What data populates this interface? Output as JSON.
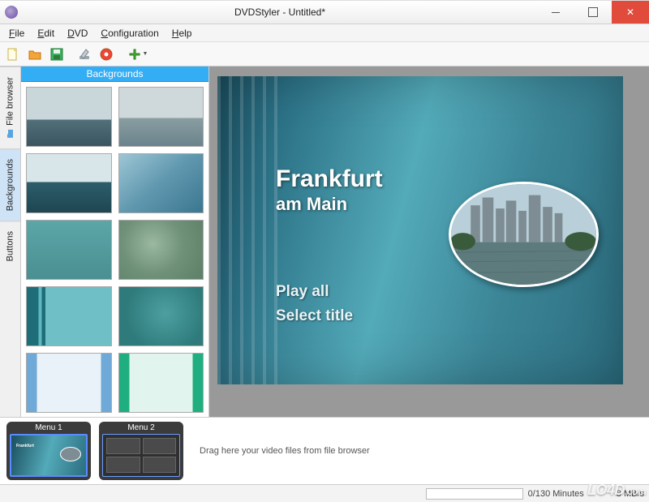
{
  "window": {
    "title": "DVDStyler - Untitled*"
  },
  "menus": {
    "file": "File",
    "edit": "Edit",
    "dvd": "DVD",
    "configuration": "Configuration",
    "help": "Help"
  },
  "toolbar": {
    "new": "new-project",
    "open": "open-project",
    "save": "save-project",
    "settings": "settings",
    "burn": "burn-dvd",
    "add": "add"
  },
  "sidetabs": {
    "file_browser": "File browser",
    "backgrounds": "Backgrounds",
    "buttons": "Buttons",
    "active": "backgrounds"
  },
  "panel": {
    "header": "Backgrounds",
    "thumbs": [
      {
        "id": "bg-ocean-island",
        "css": "linear-gradient(#c9d6da 55%,#52707a 55%,#3a5560)"
      },
      {
        "id": "bg-coast-boat",
        "css": "linear-gradient(#cfd8da 52%,#8a9ea2 52%,#6a838c)"
      },
      {
        "id": "bg-bay-point",
        "css": "linear-gradient(#d8e6ea 48%,#2d5d6b 48%,#1e4652)"
      },
      {
        "id": "bg-blue-haze",
        "css": "linear-gradient(140deg,#9dc6d6,#5f97ae,#3b7790)"
      },
      {
        "id": "bg-teal-flat",
        "css": "linear-gradient(#5ca6a8,#4a8f92)"
      },
      {
        "id": "bg-green-cloud",
        "css": "radial-gradient(circle at 40% 40%,#9bb8a1,#6f9178,#5c7f66)"
      },
      {
        "id": "bg-teal-stripes",
        "css": "linear-gradient(90deg,#1e6d78 0 14%,#5fb7bf 14% 18%,#1e6d78 18% 22%,#6fbfc6 22% 100%)"
      },
      {
        "id": "bg-teal-noise",
        "css": "radial-gradient(circle at 55% 45%,#4da0a0,#2f7b7c 70%)"
      },
      {
        "id": "bg-blue-bars",
        "css": "linear-gradient(90deg,#6fa9d8 0 12%,#e9f2f8 12% 88%,#6fa9d8 88% 100%)"
      },
      {
        "id": "bg-green-bars",
        "css": "linear-gradient(90deg,#1fae80 0 12%,#e1f5ee 12% 88%,#1fae80 88% 100%)"
      }
    ]
  },
  "preview": {
    "title_main": "Frankfurt",
    "title_sub": "am Main",
    "option1": "Play all",
    "option2": "Select title"
  },
  "timeline": {
    "items": [
      {
        "label": "Menu 1",
        "type": "preview",
        "selected": true
      },
      {
        "label": "Menu 2",
        "type": "grid4",
        "selected": false
      }
    ],
    "hint": "Drag here your video files from file browser"
  },
  "status": {
    "minutes": "0/130 Minutes",
    "rate": "8 MB/s"
  },
  "watermark": "LO4D.com"
}
